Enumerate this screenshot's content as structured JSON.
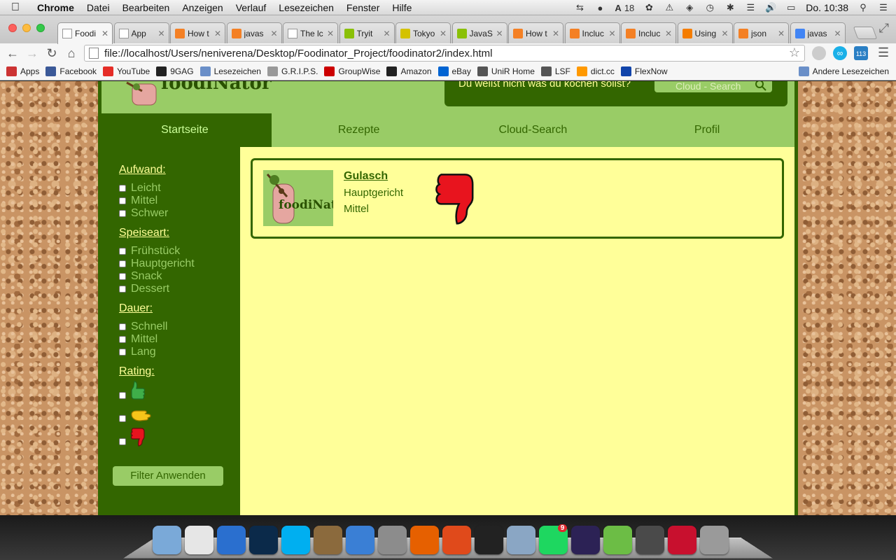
{
  "menubar": {
    "app": "Chrome",
    "items": [
      "Datei",
      "Bearbeiten",
      "Anzeigen",
      "Verlauf",
      "Lesezeichen",
      "Fenster",
      "Hilfe"
    ],
    "badge_count": "18",
    "clock": "Do. 10:38"
  },
  "tabs": [
    {
      "title": "Foodi",
      "fav_color": "#ffffff",
      "fav_icon": "page-icon"
    },
    {
      "title": "App",
      "fav_color": "#ffffff",
      "fav_icon": "page-icon"
    },
    {
      "title": "How t",
      "fav_color": "#f48024",
      "fav_icon": "stackoverflow-icon"
    },
    {
      "title": "javas",
      "fav_color": "#f48024",
      "fav_icon": "stackoverflow-icon"
    },
    {
      "title": "The lc",
      "fav_color": "#ffffff",
      "fav_icon": "page-icon"
    },
    {
      "title": "Tryit",
      "fav_color": "#8ac007",
      "fav_icon": "w3schools-icon"
    },
    {
      "title": "Tokyo",
      "fav_color": "#d4c200",
      "fav_icon": "u-icon"
    },
    {
      "title": "JavaS",
      "fav_color": "#8ac007",
      "fav_icon": "w3schools-icon"
    },
    {
      "title": "How t",
      "fav_color": "#f48024",
      "fav_icon": "stackoverflow-icon"
    },
    {
      "title": "Incluc",
      "fav_color": "#f48024",
      "fav_icon": "stackoverflow-icon"
    },
    {
      "title": "Incluc",
      "fav_color": "#f48024",
      "fav_icon": "stackoverflow-icon"
    },
    {
      "title": "Using",
      "fav_color": "#f57d00",
      "fav_icon": "blogger-icon"
    },
    {
      "title": "json",
      "fav_color": "#f48024",
      "fav_icon": "stackoverflow-icon"
    },
    {
      "title": "javas",
      "fav_color": "#4285f4",
      "fav_icon": "loading-icon"
    }
  ],
  "omnibox": {
    "url": "file://localhost/Users/neniverena/Desktop/Foodinator_Project/foodinator2/index.html"
  },
  "bookmarks": [
    {
      "label": "Apps",
      "color": "#c33"
    },
    {
      "label": "Facebook",
      "color": "#3b5998"
    },
    {
      "label": "YouTube",
      "color": "#e52d27"
    },
    {
      "label": "9GAG",
      "color": "#222"
    },
    {
      "label": "Lesezeichen",
      "color": "#6a8fc8"
    },
    {
      "label": "G.R.I.P.S.",
      "color": "#999"
    },
    {
      "label": "GroupWise",
      "color": "#c00"
    },
    {
      "label": "Amazon",
      "color": "#222"
    },
    {
      "label": "eBay",
      "color": "#0064d2"
    },
    {
      "label": "UniR Home",
      "color": "#555"
    },
    {
      "label": "LSF",
      "color": "#555"
    },
    {
      "label": "dict.cc",
      "color": "#f90"
    },
    {
      "label": "FlexNow",
      "color": "#14a"
    }
  ],
  "bookmarks_other": "Andere Lesezeichen",
  "site": {
    "logo_text": "foodiNator",
    "header_question": "Du weißt nicht was du kochen sollst?",
    "search_placeholder": "Cloud - Search",
    "nav": [
      "Startseite",
      "Rezepte",
      "Cloud-Search",
      "Profil"
    ],
    "active_nav": "Startseite",
    "filters": {
      "aufwand": {
        "title": "Aufwand:",
        "options": [
          "Leicht",
          "Mittel",
          "Schwer"
        ]
      },
      "speiseart": {
        "title": "Speiseart:",
        "options": [
          "Frühstück",
          "Hauptgericht",
          "Snack",
          "Dessert"
        ]
      },
      "dauer": {
        "title": "Dauer:",
        "options": [
          "Schnell",
          "Mittel",
          "Lang"
        ]
      },
      "rating": {
        "title": "Rating:",
        "options": [
          "thumb-up-icon",
          "thumb-sideways-icon",
          "thumb-down-icon"
        ]
      }
    },
    "filter_button": "Filter Anwenden",
    "recipes": [
      {
        "title": "Gulasch",
        "category": "Hauptgericht",
        "level": "Mittel",
        "rating": "thumb-down-icon",
        "thumb_text": "foodiNator"
      }
    ]
  },
  "colors": {
    "dark_green": "#336600",
    "light_green": "#99cc66",
    "yellow": "#ffff99",
    "thumb_down_red": "#e8141e",
    "thumb_up_green": "#3fae49",
    "thumb_side_yellow": "#f7c51a"
  },
  "dock_apps": [
    "Finder",
    "Chrome",
    "Word",
    "Photoshop",
    "Skype",
    "iPhoto",
    "iTunes",
    "System Preferences",
    "Firefox",
    "Office",
    "Terminal",
    "Mail",
    "Spotify",
    "Eclipse",
    "Brackets",
    "Sublime Text",
    "Acrobat",
    "Trash"
  ],
  "dock_badge": "9"
}
